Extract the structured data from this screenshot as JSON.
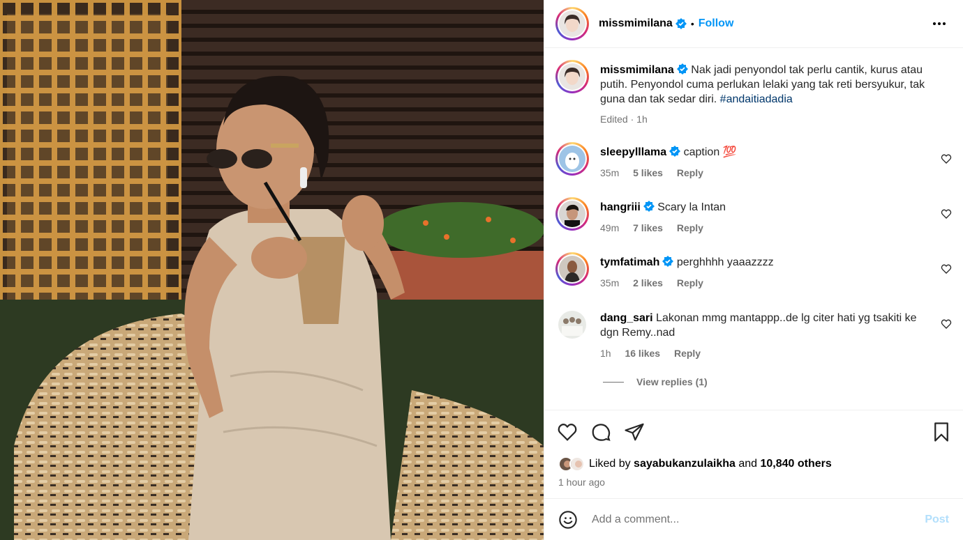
{
  "header": {
    "username": "missmimilana",
    "separator": "•",
    "follow_label": "Follow",
    "more_icon": "more-horizontal-icon"
  },
  "caption": {
    "username": "missmimilana",
    "text": "Nak jadi penyondol tak perlu cantik, kurus atau putih. Penyondol cuma perlukan lelaki yang tak reti bersyukur, tak guna dan tak sedar diri.",
    "hashtag": "#andaitiadadia",
    "edited": "Edited",
    "time": "1h"
  },
  "comments": [
    {
      "username": "sleepylllama",
      "text": "caption 💯",
      "time": "35m",
      "likes": "5 likes",
      "reply": "Reply"
    },
    {
      "username": "hangriii",
      "text": "Scary la Intan",
      "time": "49m",
      "likes": "7 likes",
      "reply": "Reply"
    },
    {
      "username": "tymfatimah",
      "text": "perghhhh yaaazzzz",
      "time": "35m",
      "likes": "2 likes",
      "reply": "Reply"
    },
    {
      "username": "dang_sari",
      "text": "Lakonan mmg mantappp..de lg citer hati yg tsakiti ke dgn Remy..nad",
      "time": "1h",
      "likes": "16 likes",
      "reply": "Reply"
    }
  ],
  "view_replies": "View replies (1)",
  "likes": {
    "prefix": "Liked by",
    "user": "sayabukanzulaikha",
    "and": "and",
    "others": "10,840 others"
  },
  "posted_time": "1 hour ago",
  "comment_box": {
    "placeholder": "Add a comment...",
    "post_label": "Post"
  },
  "colors": {
    "accent": "#0095f6",
    "post_disabled": "#b2dffc",
    "hashtag": "#00376b",
    "muted": "#737373"
  }
}
